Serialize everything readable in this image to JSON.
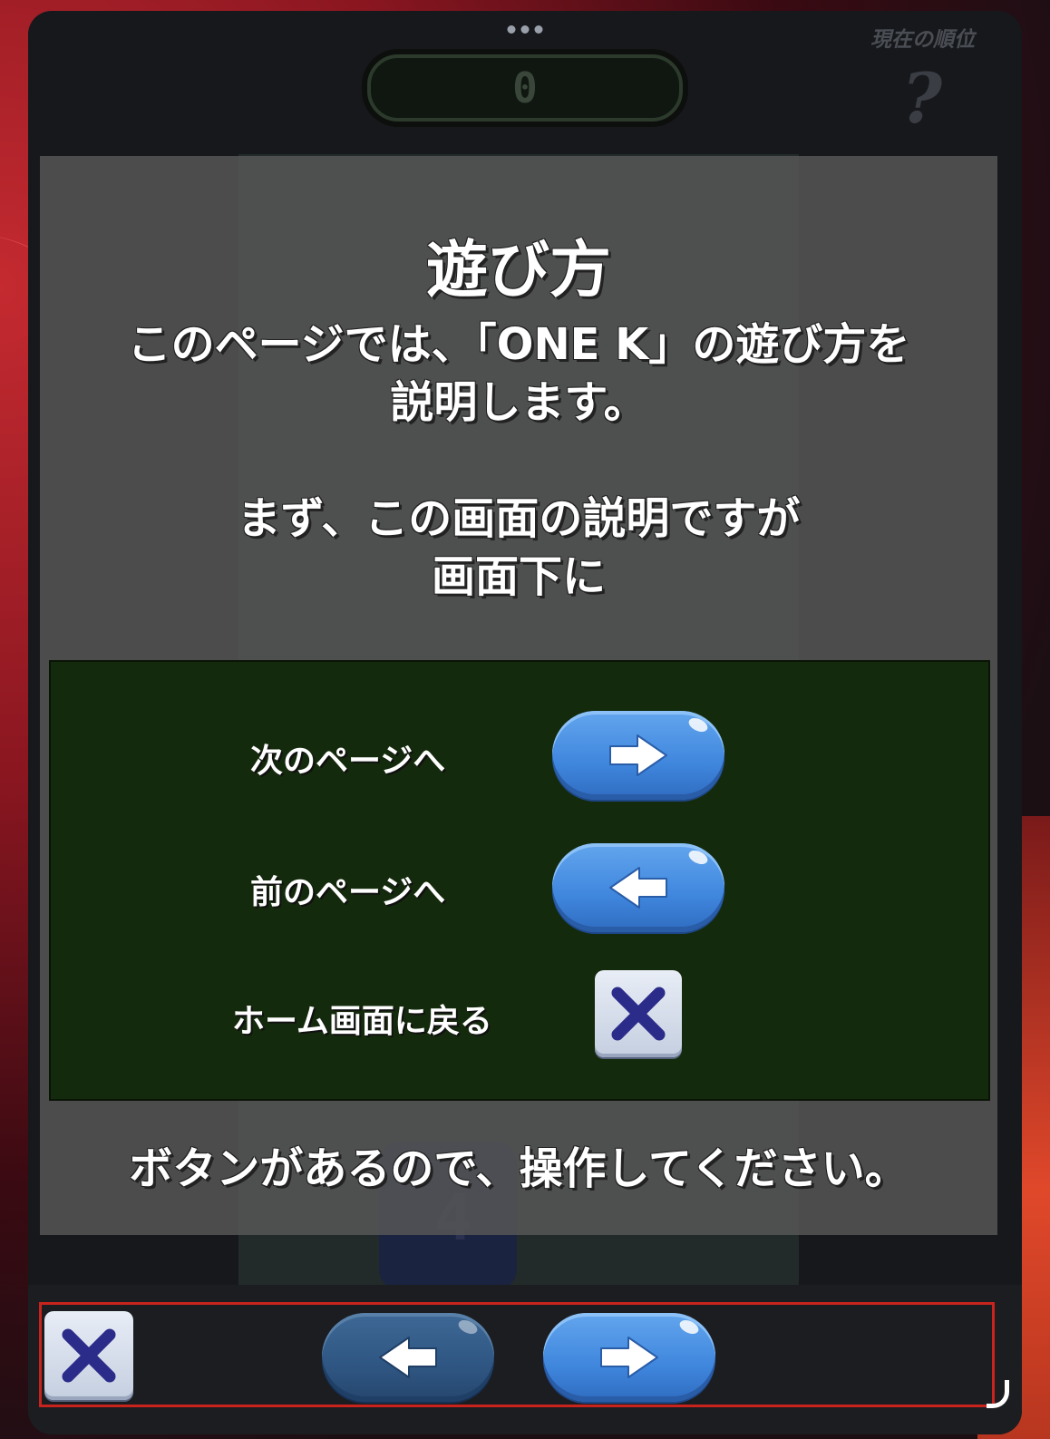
{
  "header": {
    "score": "0",
    "rank_label": "現在の順位",
    "rank_value": "?"
  },
  "board": {
    "ghost_tile_value": "4"
  },
  "modal": {
    "title": "遊び方",
    "intro": "このページでは、「ONE K」の遊び方を\n説明します。",
    "explain": "まず、この画面の説明ですが\n画面下に",
    "outro": "ボタンがあるので、操作してください。",
    "help": {
      "next_label": "次のページへ",
      "prev_label": "前のページへ",
      "home_label": "ホーム画面に戻る"
    }
  },
  "icons": {
    "next": "arrow-right-icon",
    "prev": "arrow-left-icon",
    "close": "x-icon",
    "menu": "more-dots-icon"
  },
  "colors": {
    "button_blue": "#4a90e2",
    "close_x": "#2b2b8a",
    "help_panel": "#142a0c",
    "highlight_outline": "#c8231d"
  }
}
